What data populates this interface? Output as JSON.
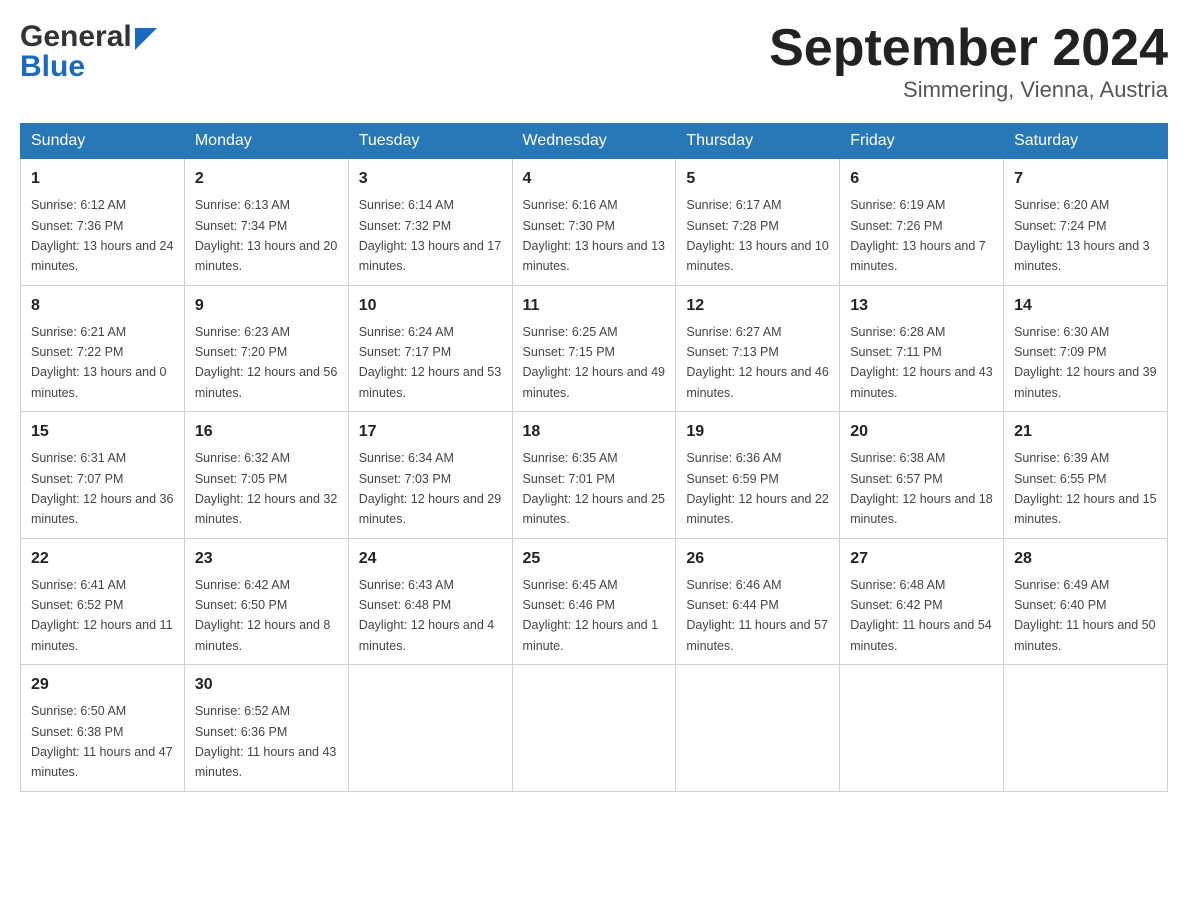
{
  "header": {
    "logo_general": "General",
    "logo_blue": "Blue",
    "month_title": "September 2024",
    "location": "Simmering, Vienna, Austria"
  },
  "days_of_week": [
    "Sunday",
    "Monday",
    "Tuesday",
    "Wednesday",
    "Thursday",
    "Friday",
    "Saturday"
  ],
  "weeks": [
    [
      {
        "day": "1",
        "sunrise": "6:12 AM",
        "sunset": "7:36 PM",
        "daylight": "13 hours and 24 minutes."
      },
      {
        "day": "2",
        "sunrise": "6:13 AM",
        "sunset": "7:34 PM",
        "daylight": "13 hours and 20 minutes."
      },
      {
        "day": "3",
        "sunrise": "6:14 AM",
        "sunset": "7:32 PM",
        "daylight": "13 hours and 17 minutes."
      },
      {
        "day": "4",
        "sunrise": "6:16 AM",
        "sunset": "7:30 PM",
        "daylight": "13 hours and 13 minutes."
      },
      {
        "day": "5",
        "sunrise": "6:17 AM",
        "sunset": "7:28 PM",
        "daylight": "13 hours and 10 minutes."
      },
      {
        "day": "6",
        "sunrise": "6:19 AM",
        "sunset": "7:26 PM",
        "daylight": "13 hours and 7 minutes."
      },
      {
        "day": "7",
        "sunrise": "6:20 AM",
        "sunset": "7:24 PM",
        "daylight": "13 hours and 3 minutes."
      }
    ],
    [
      {
        "day": "8",
        "sunrise": "6:21 AM",
        "sunset": "7:22 PM",
        "daylight": "13 hours and 0 minutes."
      },
      {
        "day": "9",
        "sunrise": "6:23 AM",
        "sunset": "7:20 PM",
        "daylight": "12 hours and 56 minutes."
      },
      {
        "day": "10",
        "sunrise": "6:24 AM",
        "sunset": "7:17 PM",
        "daylight": "12 hours and 53 minutes."
      },
      {
        "day": "11",
        "sunrise": "6:25 AM",
        "sunset": "7:15 PM",
        "daylight": "12 hours and 49 minutes."
      },
      {
        "day": "12",
        "sunrise": "6:27 AM",
        "sunset": "7:13 PM",
        "daylight": "12 hours and 46 minutes."
      },
      {
        "day": "13",
        "sunrise": "6:28 AM",
        "sunset": "7:11 PM",
        "daylight": "12 hours and 43 minutes."
      },
      {
        "day": "14",
        "sunrise": "6:30 AM",
        "sunset": "7:09 PM",
        "daylight": "12 hours and 39 minutes."
      }
    ],
    [
      {
        "day": "15",
        "sunrise": "6:31 AM",
        "sunset": "7:07 PM",
        "daylight": "12 hours and 36 minutes."
      },
      {
        "day": "16",
        "sunrise": "6:32 AM",
        "sunset": "7:05 PM",
        "daylight": "12 hours and 32 minutes."
      },
      {
        "day": "17",
        "sunrise": "6:34 AM",
        "sunset": "7:03 PM",
        "daylight": "12 hours and 29 minutes."
      },
      {
        "day": "18",
        "sunrise": "6:35 AM",
        "sunset": "7:01 PM",
        "daylight": "12 hours and 25 minutes."
      },
      {
        "day": "19",
        "sunrise": "6:36 AM",
        "sunset": "6:59 PM",
        "daylight": "12 hours and 22 minutes."
      },
      {
        "day": "20",
        "sunrise": "6:38 AM",
        "sunset": "6:57 PM",
        "daylight": "12 hours and 18 minutes."
      },
      {
        "day": "21",
        "sunrise": "6:39 AM",
        "sunset": "6:55 PM",
        "daylight": "12 hours and 15 minutes."
      }
    ],
    [
      {
        "day": "22",
        "sunrise": "6:41 AM",
        "sunset": "6:52 PM",
        "daylight": "12 hours and 11 minutes."
      },
      {
        "day": "23",
        "sunrise": "6:42 AM",
        "sunset": "6:50 PM",
        "daylight": "12 hours and 8 minutes."
      },
      {
        "day": "24",
        "sunrise": "6:43 AM",
        "sunset": "6:48 PM",
        "daylight": "12 hours and 4 minutes."
      },
      {
        "day": "25",
        "sunrise": "6:45 AM",
        "sunset": "6:46 PM",
        "daylight": "12 hours and 1 minute."
      },
      {
        "day": "26",
        "sunrise": "6:46 AM",
        "sunset": "6:44 PM",
        "daylight": "11 hours and 57 minutes."
      },
      {
        "day": "27",
        "sunrise": "6:48 AM",
        "sunset": "6:42 PM",
        "daylight": "11 hours and 54 minutes."
      },
      {
        "day": "28",
        "sunrise": "6:49 AM",
        "sunset": "6:40 PM",
        "daylight": "11 hours and 50 minutes."
      }
    ],
    [
      {
        "day": "29",
        "sunrise": "6:50 AM",
        "sunset": "6:38 PM",
        "daylight": "11 hours and 47 minutes."
      },
      {
        "day": "30",
        "sunrise": "6:52 AM",
        "sunset": "6:36 PM",
        "daylight": "11 hours and 43 minutes."
      },
      null,
      null,
      null,
      null,
      null
    ]
  ],
  "labels": {
    "sunrise": "Sunrise: ",
    "sunset": "Sunset: ",
    "daylight": "Daylight: "
  }
}
